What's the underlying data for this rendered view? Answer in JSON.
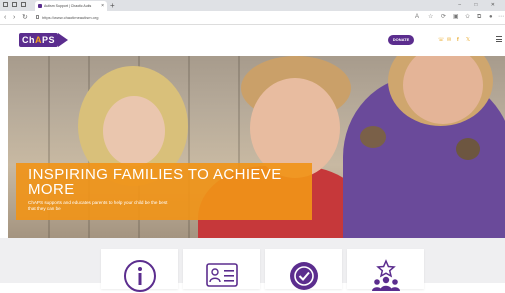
{
  "browser": {
    "tab_title": "Autism Support | Chaotic Autis",
    "tab_close": "×",
    "new_tab": "+",
    "url": "https://www.chaotimeautism.org",
    "window_controls": "– □ ✕"
  },
  "header": {
    "logo_text_1": "Ch",
    "logo_text_2": "A",
    "logo_text_3": "PS",
    "donate_label": "DONATE",
    "social": [
      "phone-icon",
      "email-icon",
      "facebook-icon",
      "twitter-icon"
    ],
    "menu_icon": "hamburger-icon"
  },
  "hero": {
    "title_line1": "INSPIRING FAMILIES TO ACHIEVE",
    "title_line2": "MORE",
    "subtitle": "ChAPS supports and educates parents to help your child be the best that they can be"
  },
  "cards": [
    {
      "icon": "info-icon"
    },
    {
      "icon": "id-card-icon"
    },
    {
      "icon": "badge-check-icon"
    },
    {
      "icon": "community-star-icon"
    }
  ],
  "colors": {
    "brand_purple": "#5b2d8e",
    "accent_orange": "#f09418"
  }
}
